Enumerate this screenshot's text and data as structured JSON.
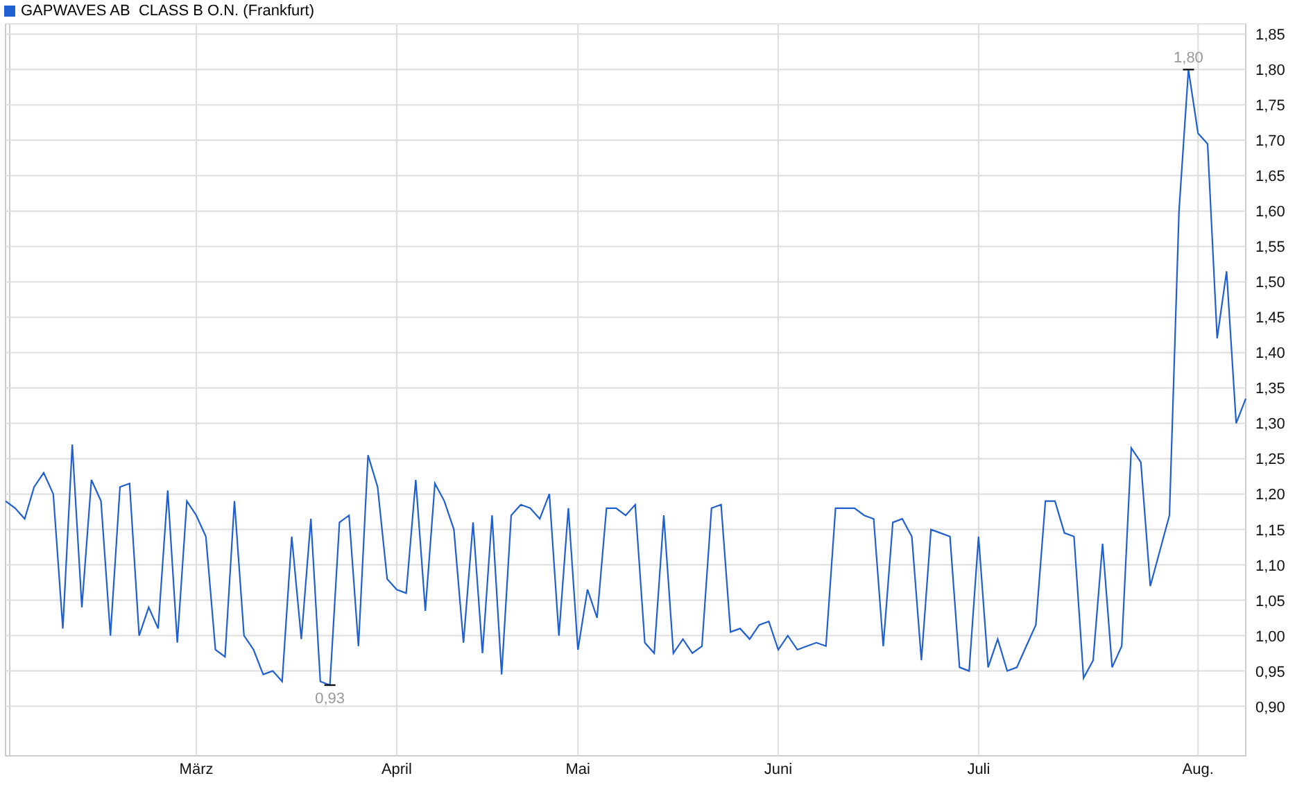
{
  "chart": {
    "chart_data": {
      "type": "line",
      "grid": true,
      "ylim": [
        0.83,
        1.865
      ],
      "categories": [
        null,
        null,
        null,
        null,
        null,
        null,
        null,
        null,
        null,
        null,
        null,
        null,
        null,
        null,
        null,
        null,
        null,
        null,
        null,
        null,
        "März",
        null,
        null,
        null,
        null,
        null,
        null,
        null,
        null,
        null,
        null,
        null,
        null,
        null,
        null,
        null,
        null,
        null,
        null,
        null,
        null,
        "April",
        null,
        null,
        null,
        null,
        null,
        null,
        null,
        null,
        null,
        null,
        null,
        null,
        null,
        null,
        null,
        null,
        null,
        null,
        "Mai",
        null,
        null,
        null,
        null,
        null,
        null,
        null,
        null,
        null,
        null,
        null,
        null,
        null,
        null,
        null,
        null,
        null,
        null,
        null,
        null,
        "Juni",
        null,
        null,
        null,
        null,
        null,
        null,
        null,
        null,
        null,
        null,
        null,
        null,
        null,
        null,
        null,
        null,
        null,
        null,
        null,
        null,
        "Juli",
        null,
        null,
        null,
        null,
        null,
        null,
        null,
        null,
        null,
        null,
        null,
        null,
        null,
        null,
        null,
        null,
        null,
        null,
        null,
        null,
        null,
        null,
        "Aug.",
        null,
        null,
        null,
        null,
        null
      ],
      "yticks": [
        {
          "value": 0.9,
          "label": "0,90"
        },
        {
          "value": 0.95,
          "label": "0,95"
        },
        {
          "value": 1.0,
          "label": "1,00"
        },
        {
          "value": 1.05,
          "label": "1,05"
        },
        {
          "value": 1.1,
          "label": "1,10"
        },
        {
          "value": 1.15,
          "label": "1,15"
        },
        {
          "value": 1.2,
          "label": "1,20"
        },
        {
          "value": 1.25,
          "label": "1,25"
        },
        {
          "value": 1.3,
          "label": "1,30"
        },
        {
          "value": 1.35,
          "label": "1,35"
        },
        {
          "value": 1.4,
          "label": "1,40"
        },
        {
          "value": 1.45,
          "label": "1,45"
        },
        {
          "value": 1.5,
          "label": "1,50"
        },
        {
          "value": 1.55,
          "label": "1,55"
        },
        {
          "value": 1.6,
          "label": "1,60"
        },
        {
          "value": 1.65,
          "label": "1,65"
        },
        {
          "value": 1.7,
          "label": "1,70"
        },
        {
          "value": 1.75,
          "label": "1,75"
        },
        {
          "value": 1.8,
          "label": "1,80"
        },
        {
          "value": 1.85,
          "label": "1,85"
        }
      ],
      "series": [
        {
          "name": "GAPWAVES AB  CLASS B O.N. (Frankfurt)",
          "color": "#1f5fcf",
          "values": [
            1.19,
            1.18,
            1.165,
            1.21,
            1.23,
            1.2,
            1.01,
            1.27,
            1.04,
            1.22,
            1.19,
            1.0,
            1.21,
            1.215,
            1.0,
            1.04,
            1.01,
            1.205,
            0.99,
            1.19,
            1.17,
            1.14,
            0.98,
            0.97,
            1.19,
            1.0,
            0.98,
            0.945,
            0.95,
            0.935,
            1.14,
            0.995,
            1.165,
            0.935,
            0.93,
            1.16,
            1.17,
            0.985,
            1.255,
            1.21,
            1.08,
            1.065,
            1.06,
            1.22,
            1.035,
            1.215,
            1.19,
            1.15,
            0.99,
            1.16,
            0.975,
            1.17,
            0.945,
            1.17,
            1.185,
            1.18,
            1.165,
            1.2,
            1.0,
            1.18,
            0.98,
            1.065,
            1.025,
            1.18,
            1.18,
            1.17,
            1.185,
            0.99,
            0.975,
            1.17,
            0.975,
            0.995,
            0.975,
            0.985,
            1.18,
            1.185,
            1.005,
            1.01,
            0.995,
            1.015,
            1.02,
            0.98,
            1.0,
            0.98,
            0.985,
            0.99,
            0.985,
            1.18,
            1.18,
            1.18,
            1.17,
            1.165,
            0.985,
            1.16,
            1.165,
            1.14,
            0.965,
            1.15,
            1.145,
            1.14,
            0.955,
            0.95,
            1.14,
            0.955,
            0.995,
            0.95,
            0.955,
            0.985,
            1.015,
            1.19,
            1.19,
            1.145,
            1.14,
            0.94,
            0.965,
            1.13,
            0.955,
            0.985,
            1.265,
            1.245,
            1.07,
            1.12,
            1.17,
            1.6,
            1.8,
            1.71,
            1.695,
            1.42,
            1.515,
            1.3,
            1.335
          ]
        }
      ],
      "annotations": [
        {
          "text": "0,93",
          "y": 0.93
        },
        {
          "text": "1,80",
          "y": 1.8
        }
      ]
    }
  }
}
